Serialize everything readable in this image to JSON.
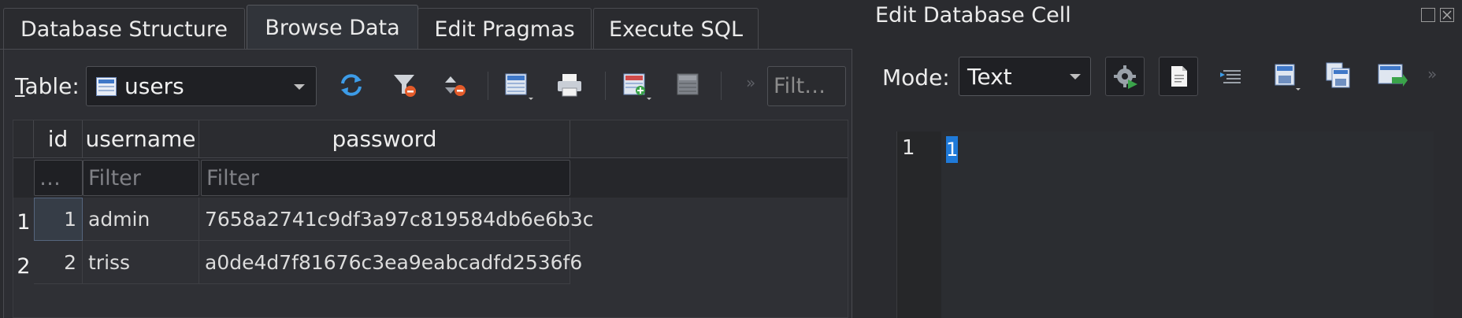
{
  "tabs": [
    {
      "label": "Database Structure",
      "active": false
    },
    {
      "label": "Browse Data",
      "active": true
    },
    {
      "label": "Edit Pragmas",
      "active": false
    },
    {
      "label": "Execute SQL",
      "active": false
    }
  ],
  "browse": {
    "table_label_accel": "T",
    "table_label_rest": "able:",
    "table_value": "users",
    "filter_placeholder": "Filt…",
    "toolbar_icons": [
      "refresh-icon",
      "clear-filters-icon",
      "sort-icon",
      "save-table-icon",
      "print-icon",
      "insert-record-icon",
      "delete-record-icon"
    ]
  },
  "grid": {
    "columns": [
      "id",
      "username",
      "password"
    ],
    "filter_placeholders": [
      "…",
      "Filter",
      "Filter"
    ],
    "rows": [
      {
        "num": "1",
        "id": "1",
        "username": "admin",
        "password": "7658a2741c9df3a97c819584db6e6b3c"
      },
      {
        "num": "2",
        "id": "2",
        "username": "triss",
        "password": "a0de4d7f81676c3ea9eabcadfd2536f6"
      }
    ]
  },
  "edit_cell": {
    "title": "Edit Database Cell",
    "mode_label": "Mode:",
    "mode_value": "Text",
    "line_number": "1",
    "content": "1",
    "toolbar_icons": [
      "auto-format-icon",
      "text-document-icon",
      "word-wrap-icon",
      "import-icon",
      "export-icon",
      "apply-icon"
    ]
  },
  "colors": {
    "background": "#2a2b2f",
    "selection": "#1f7ad9"
  }
}
